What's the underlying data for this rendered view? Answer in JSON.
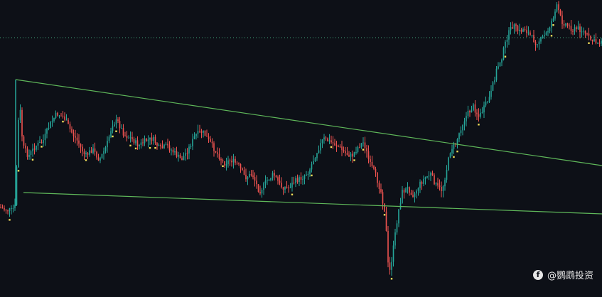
{
  "watermark": {
    "text": "@鹦鹉投资",
    "icon": "facebook-icon"
  },
  "colors": {
    "background": "#0d1017",
    "up": "#26a69a",
    "down": "#ef5350",
    "trendline": "#5fb85a",
    "marker": "#f5e15a",
    "price_line": "#3fa37a"
  },
  "chart_data": {
    "type": "candlestick",
    "title": "",
    "xlabel": "",
    "ylabel": "",
    "grid": false,
    "ylim": [
      0,
      418
    ],
    "reference_level": 53,
    "close_path": [
      [
        0,
        292
      ],
      [
        8,
        295
      ],
      [
        16,
        296
      ],
      [
        22,
        290
      ],
      [
        25,
        180
      ],
      [
        28,
        150
      ],
      [
        32,
        205
      ],
      [
        40,
        220
      ],
      [
        50,
        205
      ],
      [
        60,
        200
      ],
      [
        70,
        175
      ],
      [
        80,
        160
      ],
      [
        90,
        165
      ],
      [
        100,
        185
      ],
      [
        110,
        200
      ],
      [
        120,
        220
      ],
      [
        130,
        210
      ],
      [
        140,
        225
      ],
      [
        150,
        205
      ],
      [
        158,
        175
      ],
      [
        165,
        170
      ],
      [
        175,
        190
      ],
      [
        185,
        195
      ],
      [
        195,
        205
      ],
      [
        205,
        198
      ],
      [
        215,
        195
      ],
      [
        225,
        210
      ],
      [
        235,
        205
      ],
      [
        245,
        215
      ],
      [
        255,
        225
      ],
      [
        265,
        210
      ],
      [
        275,
        190
      ],
      [
        285,
        185
      ],
      [
        295,
        200
      ],
      [
        305,
        215
      ],
      [
        315,
        230
      ],
      [
        325,
        225
      ],
      [
        335,
        232
      ],
      [
        345,
        250
      ],
      [
        355,
        245
      ],
      [
        365,
        270
      ],
      [
        375,
        255
      ],
      [
        385,
        245
      ],
      [
        395,
        262
      ],
      [
        405,
        265
      ],
      [
        415,
        255
      ],
      [
        425,
        250
      ],
      [
        435,
        240
      ],
      [
        445,
        215
      ],
      [
        455,
        195
      ],
      [
        465,
        200
      ],
      [
        475,
        205
      ],
      [
        485,
        215
      ],
      [
        495,
        220
      ],
      [
        505,
        205
      ],
      [
        512,
        200
      ],
      [
        520,
        230
      ],
      [
        528,
        245
      ],
      [
        536,
        270
      ],
      [
        542,
        300
      ],
      [
        547,
        390
      ],
      [
        552,
        360
      ],
      [
        556,
        330
      ],
      [
        560,
        300
      ],
      [
        566,
        270
      ],
      [
        574,
        265
      ],
      [
        582,
        275
      ],
      [
        590,
        260
      ],
      [
        598,
        250
      ],
      [
        606,
        245
      ],
      [
        614,
        262
      ],
      [
        622,
        268
      ],
      [
        628,
        240
      ],
      [
        634,
        210
      ],
      [
        642,
        200
      ],
      [
        650,
        175
      ],
      [
        658,
        160
      ],
      [
        666,
        150
      ],
      [
        674,
        165
      ],
      [
        682,
        150
      ],
      [
        690,
        135
      ],
      [
        698,
        100
      ],
      [
        706,
        80
      ],
      [
        714,
        50
      ],
      [
        722,
        35
      ],
      [
        730,
        45
      ],
      [
        738,
        40
      ],
      [
        746,
        50
      ],
      [
        754,
        60
      ],
      [
        762,
        55
      ],
      [
        770,
        45
      ],
      [
        778,
        25
      ],
      [
        784,
        8
      ],
      [
        790,
        30
      ],
      [
        798,
        35
      ],
      [
        806,
        42
      ],
      [
        814,
        40
      ],
      [
        822,
        45
      ],
      [
        830,
        55
      ],
      [
        838,
        60
      ],
      [
        847,
        58
      ]
    ],
    "trendlines": [
      {
        "name": "upper",
        "from": [
          22,
          112
        ],
        "to": [
          847,
          233
        ]
      },
      {
        "name": "lower",
        "from": [
          33,
          271
        ],
        "to": [
          847,
          301
        ]
      }
    ],
    "spike": {
      "from": [
        22,
        290
      ],
      "to": [
        22,
        112
      ]
    }
  }
}
